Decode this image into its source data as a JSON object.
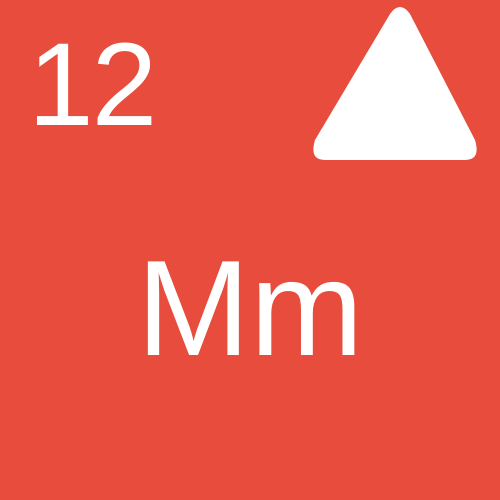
{
  "tile": {
    "number": "12",
    "symbol": "Mm",
    "icon": "triangle-up-icon",
    "background_color": "#e74c3c",
    "foreground_color": "#ffffff"
  }
}
